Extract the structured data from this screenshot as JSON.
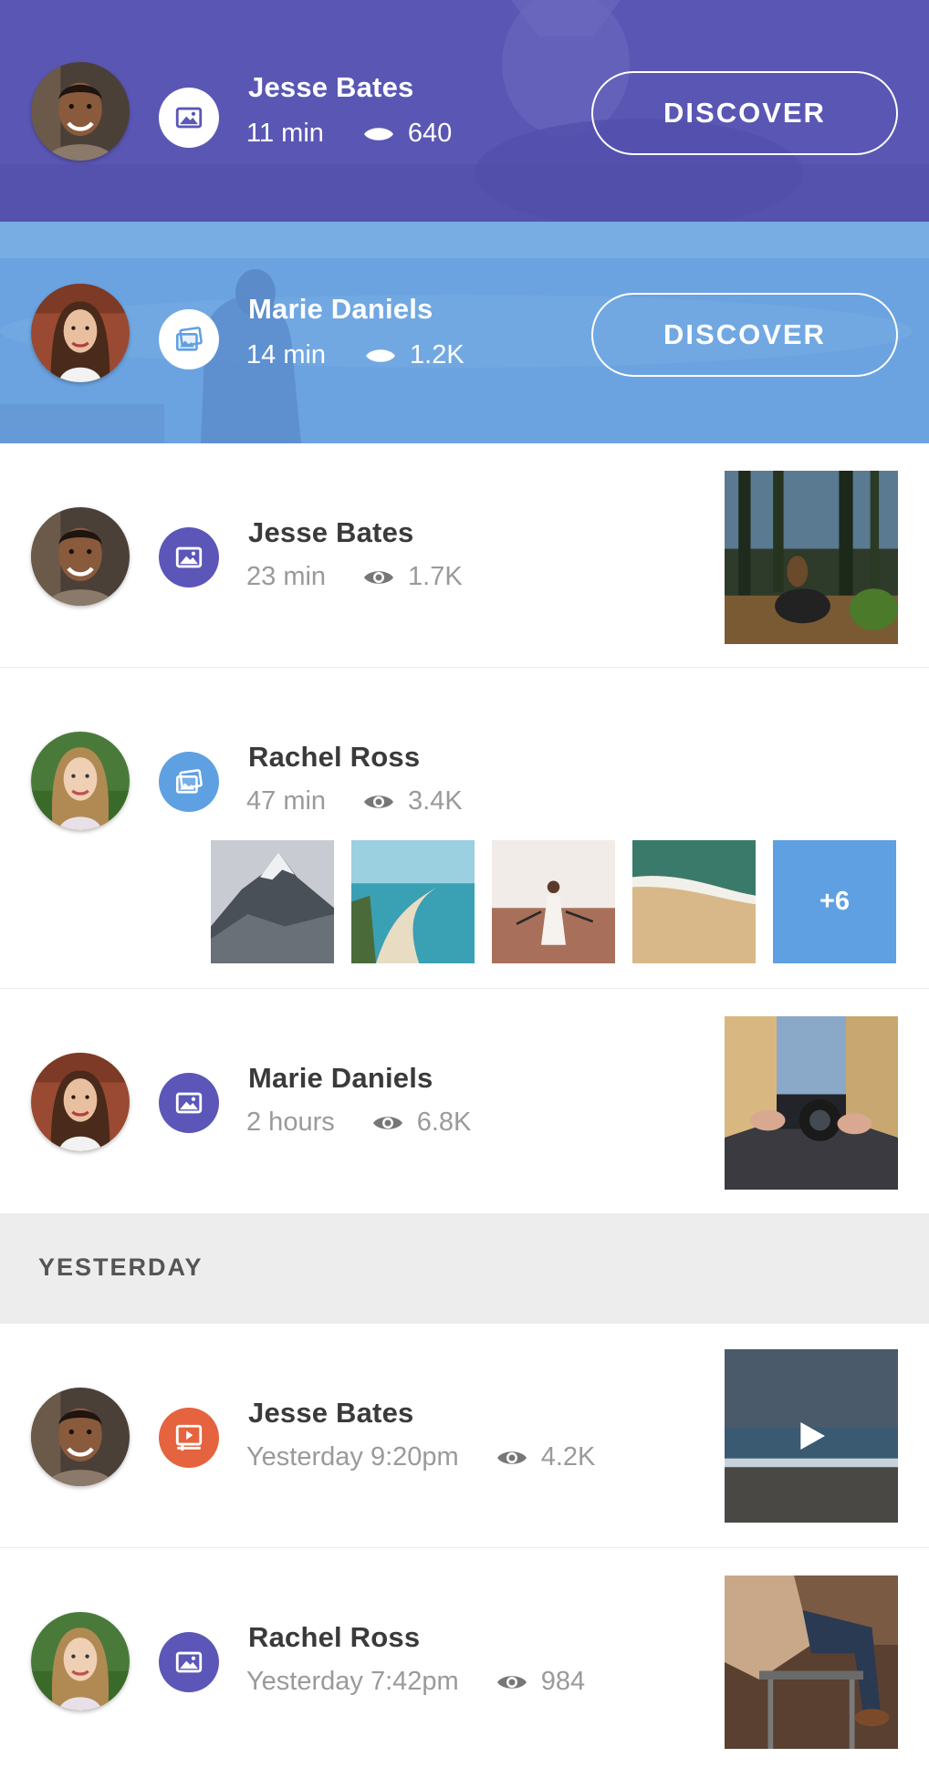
{
  "colors": {
    "featured_1": "#5a57b4",
    "featured_2": "#6ba3e0",
    "icon_purple": "#5b56b8",
    "icon_blue": "#5fa0e2",
    "icon_orange": "#e5633f",
    "more_tile": "#5fa0e2"
  },
  "featured": [
    {
      "name": "Jesse Bates",
      "time": "11 min",
      "views": "640",
      "button": "DISCOVER",
      "type_icon": "image-icon",
      "avatar": "man-avatar"
    },
    {
      "name": "Marie Daniels",
      "time": "14 min",
      "views": "1.2K",
      "button": "DISCOVER",
      "type_icon": "gallery-icon",
      "avatar": "woman-brunette-avatar"
    }
  ],
  "feed": [
    {
      "name": "Jesse Bates",
      "time": "23 min",
      "views": "1.7K",
      "type_icon": "image-icon",
      "avatar": "man-avatar",
      "thumb": "forest-photo"
    },
    {
      "name": "Rachel Ross",
      "time": "47 min",
      "views": "3.4K",
      "type_icon": "gallery-icon",
      "avatar": "woman-blonde-avatar",
      "gallery_more": "+6"
    },
    {
      "name": "Marie Daniels",
      "time": "2 hours",
      "views": "6.8K",
      "type_icon": "image-icon",
      "avatar": "woman-brunette-avatar",
      "thumb": "camera-photo"
    }
  ],
  "section": {
    "title": "YESTERDAY"
  },
  "yesterday": [
    {
      "name": "Jesse Bates",
      "time": "Yesterday 9:20pm",
      "views": "4.2K",
      "type_icon": "video-icon",
      "avatar": "man-avatar",
      "thumb": "beach-video"
    },
    {
      "name": "Rachel Ross",
      "time": "Yesterday 7:42pm",
      "views": "984",
      "type_icon": "image-icon",
      "avatar": "woman-blonde-avatar",
      "thumb": "chair-photo"
    }
  ]
}
